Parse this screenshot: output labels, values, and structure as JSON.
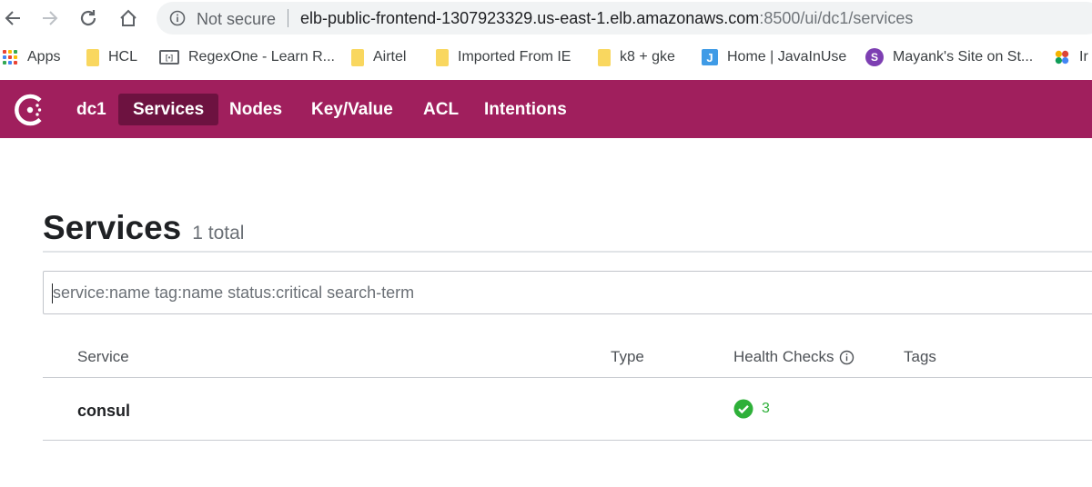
{
  "browser": {
    "security_label": "Not secure",
    "url_host": "elb-public-frontend-1307923329.us-east-1.elb.amazonaws.com",
    "url_path": ":8500/ui/dc1/services"
  },
  "bookmarks": [
    {
      "label": "Apps",
      "icon": "apps-grid-icon"
    },
    {
      "label": "HCL",
      "icon": "folder-icon"
    },
    {
      "label": "RegexOne - Learn R...",
      "icon": "film-icon"
    },
    {
      "label": "Airtel",
      "icon": "folder-icon"
    },
    {
      "label": "Imported From IE",
      "icon": "folder-icon"
    },
    {
      "label": "k8 + gke",
      "icon": "folder-icon"
    },
    {
      "label": "Home | JavaInUse",
      "icon": "j-icon",
      "icon_text": "J"
    },
    {
      "label": "Mayank's Site on St...",
      "icon": "s-icon",
      "icon_text": "S"
    },
    {
      "label": "Ir",
      "icon": "colorful-dots-icon"
    }
  ],
  "consul": {
    "datacenter": "dc1",
    "nav": [
      "Services",
      "Nodes",
      "Key/Value",
      "ACL",
      "Intentions"
    ],
    "active_nav": "Services",
    "brand_color": "#a01f5d",
    "active_color": "#6d1240"
  },
  "page": {
    "title": "Services",
    "count": "1 total",
    "search_placeholder": "service:name tag:name status:critical search-term"
  },
  "table": {
    "headers": {
      "service": "Service",
      "type": "Type",
      "health": "Health Checks",
      "tags": "Tags"
    },
    "rows": [
      {
        "service": "consul",
        "type": "",
        "health_passing": "3",
        "tags": ""
      }
    ]
  },
  "colors": {
    "passing": "#2eb039"
  }
}
